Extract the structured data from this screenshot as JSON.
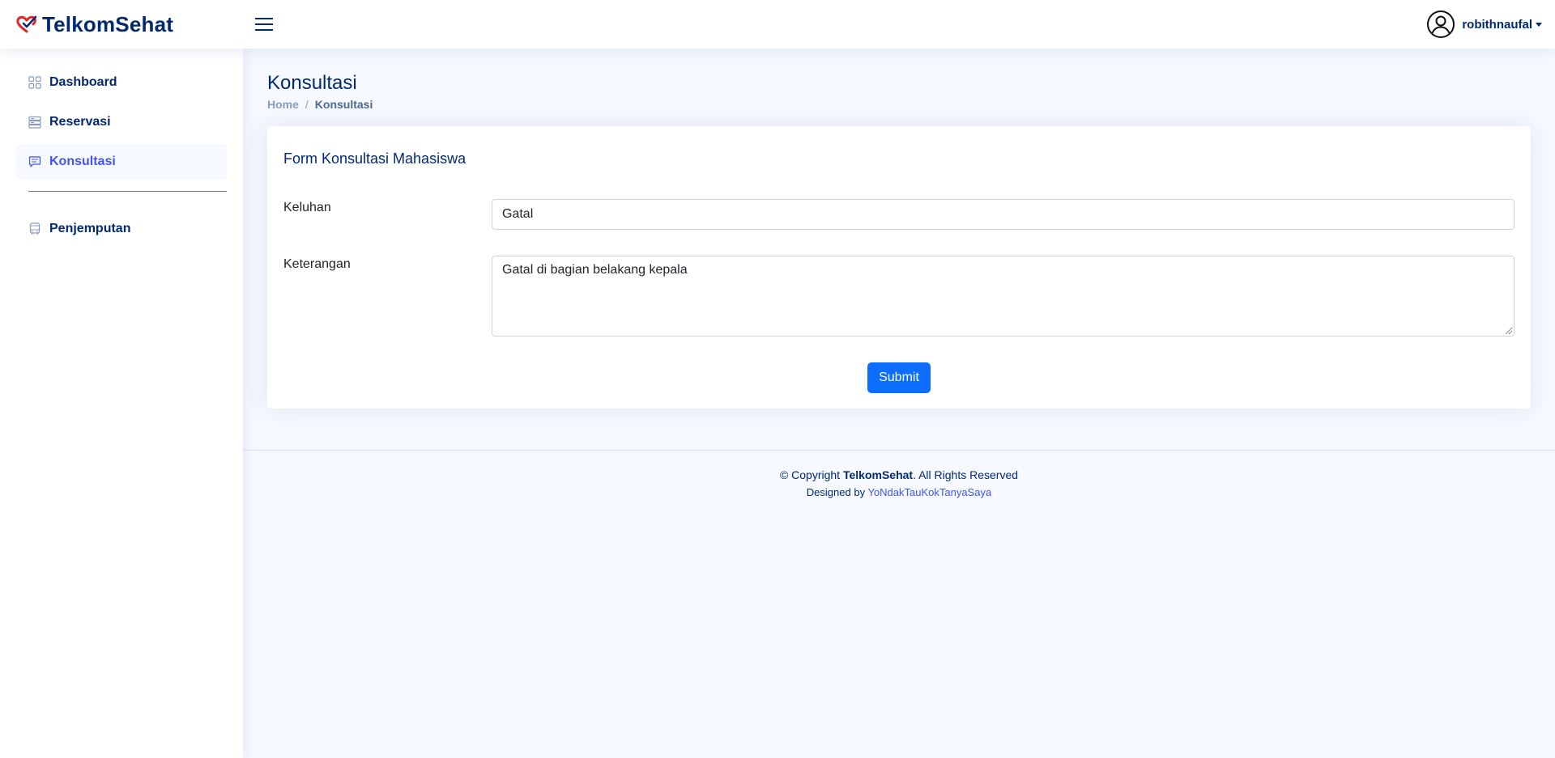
{
  "app": {
    "brand": "TelkomSehat"
  },
  "header": {
    "username": "robithnaufal"
  },
  "sidebar": {
    "items": [
      {
        "label": "Dashboard",
        "icon": "grid-icon"
      },
      {
        "label": "Reservasi",
        "icon": "server-icon"
      },
      {
        "label": "Konsultasi",
        "icon": "chat-icon",
        "active": true
      },
      {
        "label": "Penjemputan",
        "icon": "bus-icon"
      }
    ]
  },
  "page": {
    "title": "Konsultasi",
    "breadcrumb": {
      "home": "Home",
      "separator": "/",
      "current": "Konsultasi"
    }
  },
  "form": {
    "title": "Form Konsultasi Mahasiswa",
    "keluhan_label": "Keluhan",
    "keluhan_value": "Gatal",
    "keterangan_label": "Keterangan",
    "keterangan_value": "Gatal di bagian belakang kepala",
    "submit_label": "Submit"
  },
  "footer": {
    "copyright_prefix": "© Copyright ",
    "copyright_brand": "TelkomSehat",
    "copyright_suffix": ". All Rights Reserved",
    "designed_prefix": "Designed by ",
    "designer": "YoNdakTauKokTanyaSaya"
  },
  "colors": {
    "primary": "#012970",
    "accent": "#4154f1",
    "button": "#0d6efd",
    "logo_red": "#e0272d"
  }
}
